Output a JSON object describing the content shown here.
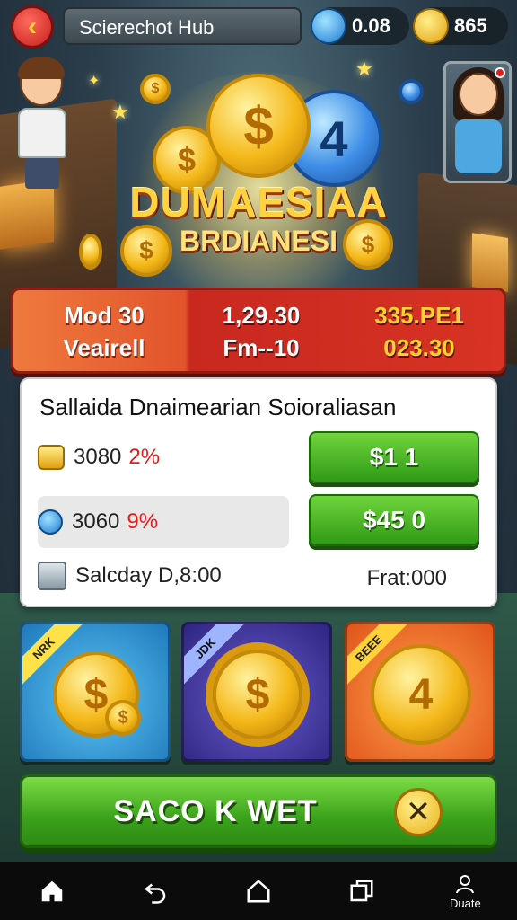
{
  "header": {
    "back_icon": "chevron-left-icon",
    "title": "Scierechot Hub",
    "gem_value": "0.08",
    "gold_value": "865"
  },
  "hero": {
    "title": "DUMAESIAA",
    "subtitle": "BRDIANESI",
    "big_coin_symbol": "$",
    "blue_coin_symbol": "4"
  },
  "stats": {
    "col1_line1": "Mod 30",
    "col1_line2": "Veairell",
    "col2_line1": "1,29.30",
    "col2_line2": "Fm--10",
    "col3_line1": "335.PE1",
    "col3_line2": "023.30"
  },
  "panel": {
    "title": "Sallaida Dnaimearian Soioraliasan",
    "rows": [
      {
        "amount": "3080",
        "percent": "2%",
        "button": "$1 1"
      },
      {
        "amount": "3060",
        "percent": "9%",
        "button": "$45 0"
      }
    ],
    "footer_left": "Salcday D,8:00",
    "footer_right": "Frat:000"
  },
  "packs": [
    {
      "ribbon": "NRK",
      "coin": "$"
    },
    {
      "ribbon": "JDK",
      "coin": "$"
    },
    {
      "ribbon": "BEEE",
      "coin": "4"
    }
  ],
  "action": {
    "label": "SACO K WET",
    "close_symbol": "✕"
  },
  "nav": {
    "home_icon": "home-icon",
    "back_icon": "back-arrow-icon",
    "house_icon": "house-outline-icon",
    "windows_icon": "recent-apps-icon",
    "profile_label": "Duate"
  },
  "colors": {
    "accent_green": "#3aa21b",
    "stats_red": "#c9281f",
    "gold": "#f4b819"
  }
}
